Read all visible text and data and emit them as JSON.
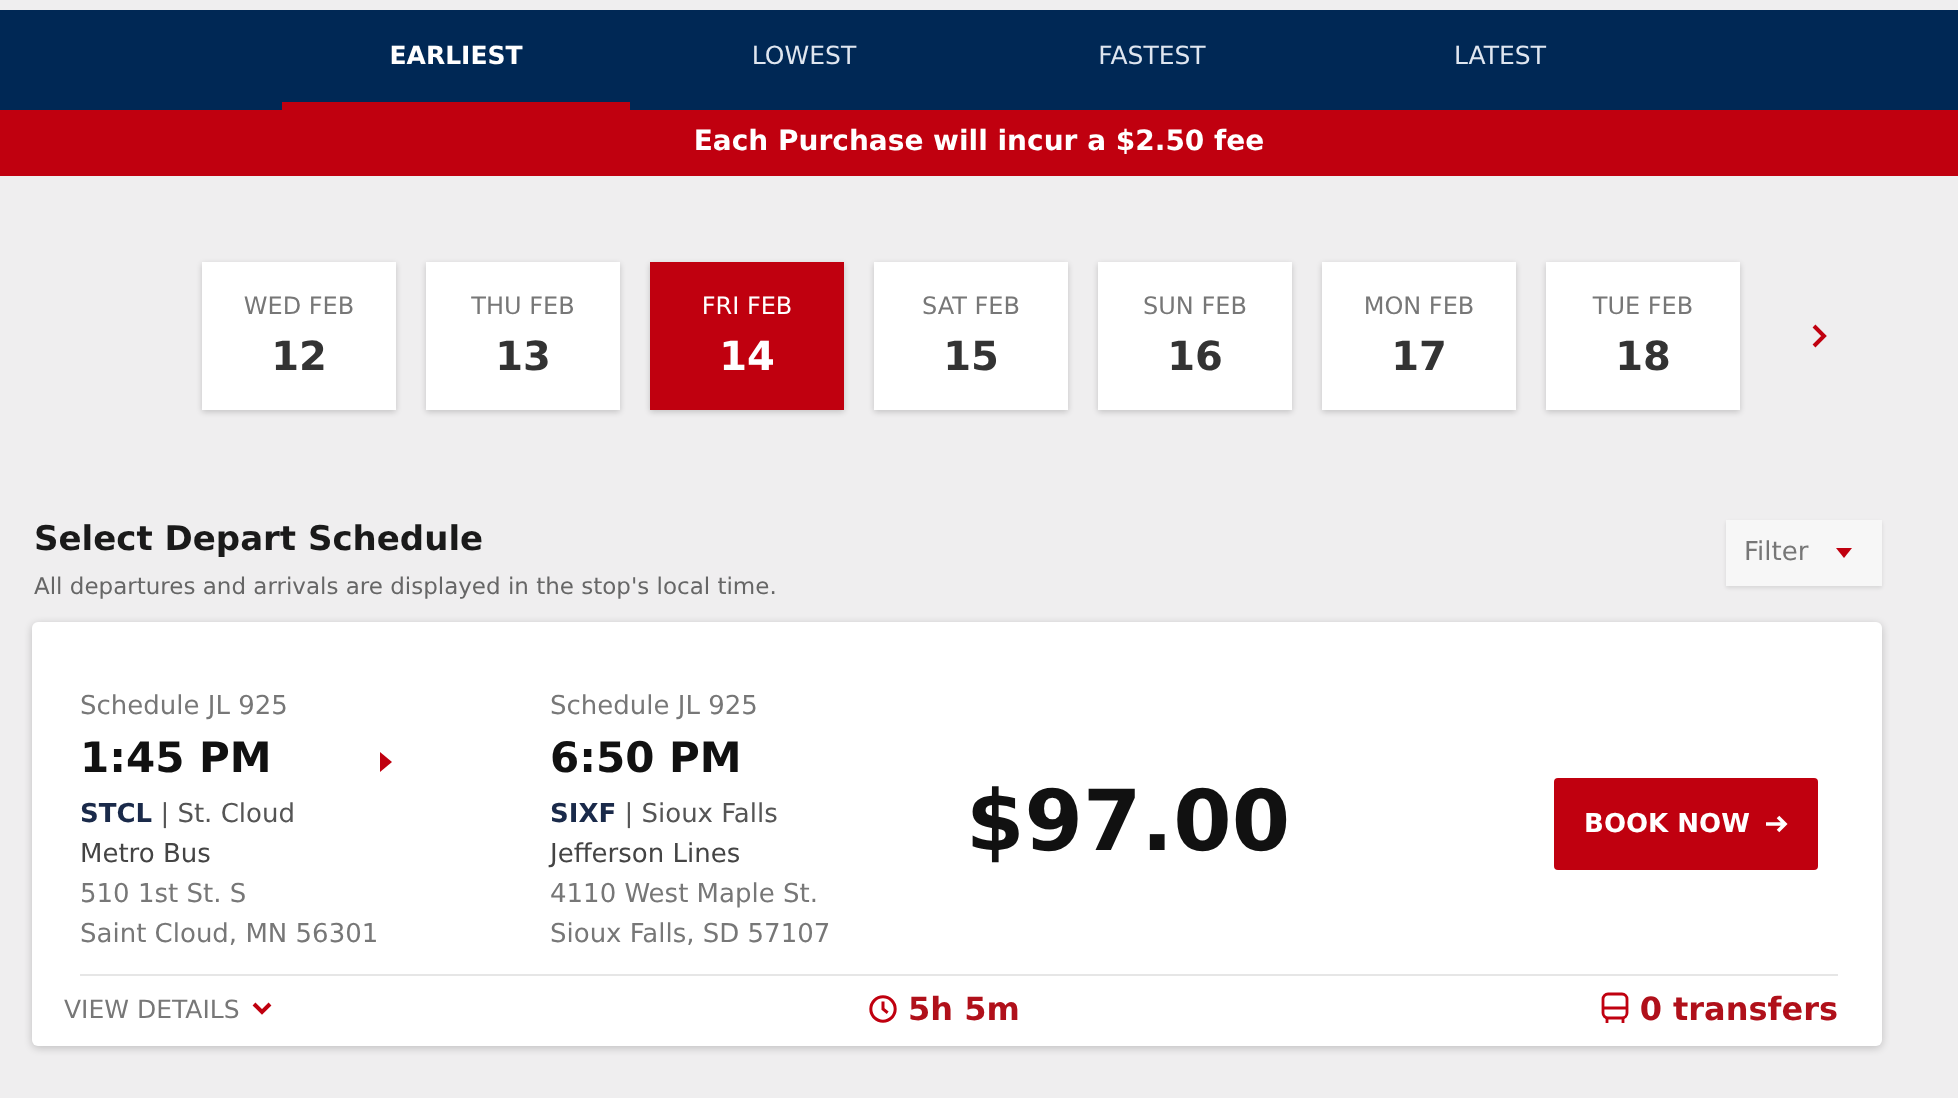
{
  "sort_tabs": [
    {
      "label": "EARLIEST",
      "selected": true
    },
    {
      "label": "LOWEST",
      "selected": false
    },
    {
      "label": "FASTEST",
      "selected": false
    },
    {
      "label": "LATEST",
      "selected": false
    }
  ],
  "fee_banner": "Each Purchase will incur a $2.50 fee",
  "dates": [
    {
      "weekday": "WED FEB",
      "day": "12",
      "selected": false
    },
    {
      "weekday": "THU FEB",
      "day": "13",
      "selected": false
    },
    {
      "weekday": "FRI FEB",
      "day": "14",
      "selected": true
    },
    {
      "weekday": "SAT FEB",
      "day": "15",
      "selected": false
    },
    {
      "weekday": "SUN FEB",
      "day": "16",
      "selected": false
    },
    {
      "weekday": "MON FEB",
      "day": "17",
      "selected": false
    },
    {
      "weekday": "TUE FEB",
      "day": "18",
      "selected": false
    }
  ],
  "section": {
    "title": "Select Depart Schedule",
    "subtitle": "All departures and arrivals are displayed in the stop's local time.",
    "filter": "Filter"
  },
  "trip": {
    "depart": {
      "schedule": "Schedule JL 925",
      "time": "1:45 PM",
      "station": "**STCL** | St. Cloud",
      "carrier": "Metro Bus",
      "address": "510 1st St. S",
      "locality": "Saint Cloud, MN 56301"
    },
    "arrive": {
      "schedule": "Schedule JL 925",
      "time": "6:50 PM",
      "station": "**SIXF** | Sioux Falls",
      "carrier": "Jefferson Lines",
      "address": "4110 West Maple St.",
      "locality": "Sioux Falls, SD 57107"
    },
    "price": "$97.00",
    "book": "BOOK NOW",
    "details": "VIEW DETAILS",
    "duration": "5h 5m",
    "transfers": "0 transfers"
  }
}
